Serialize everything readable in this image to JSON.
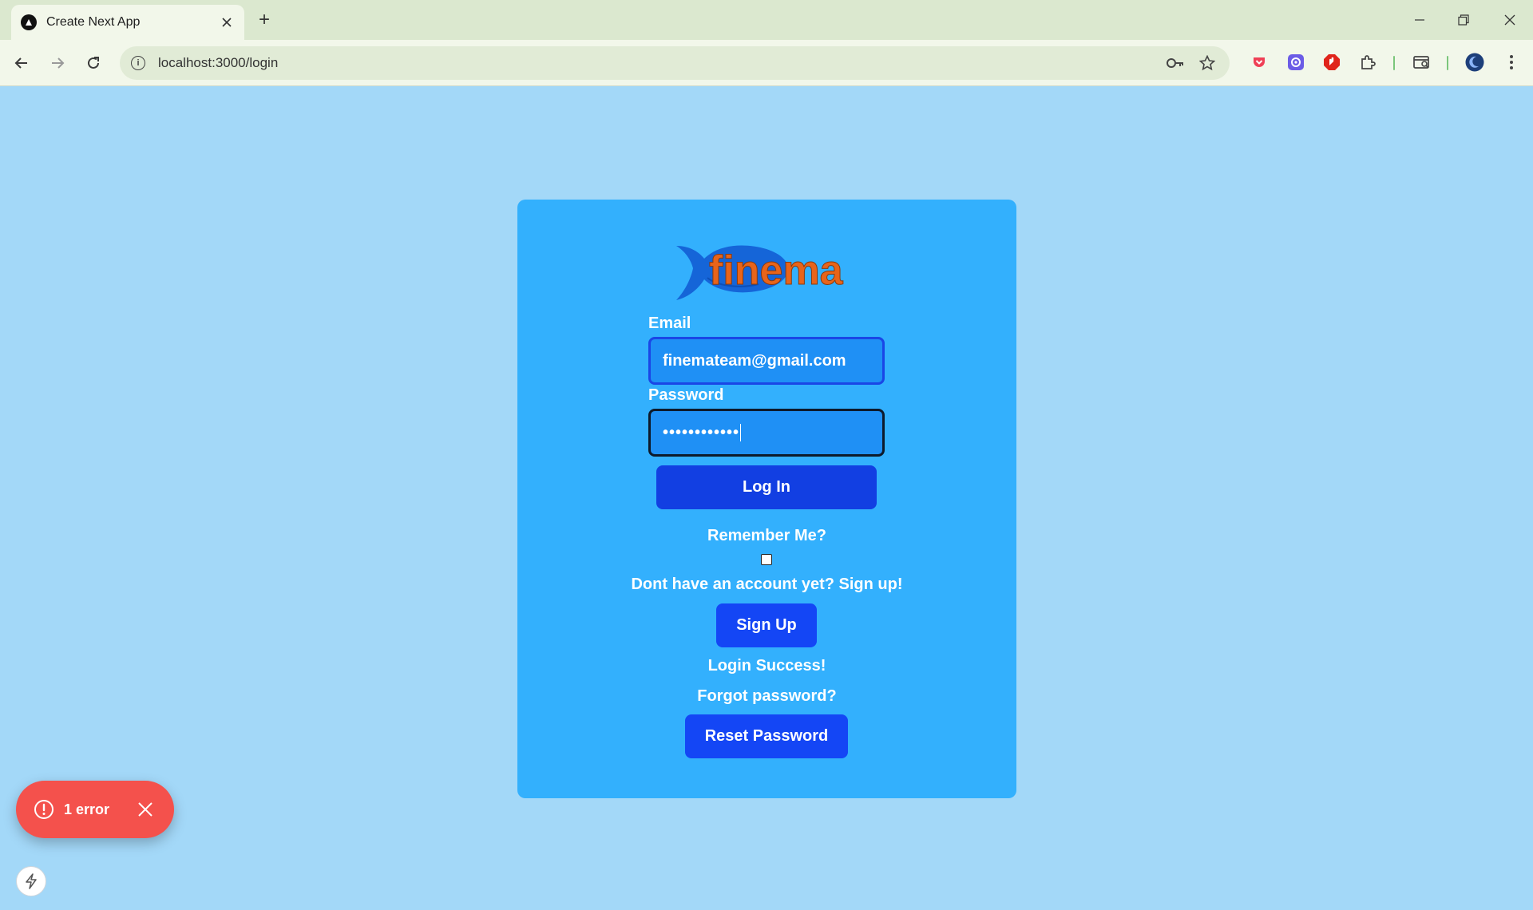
{
  "browser": {
    "tab_title": "Create Next App",
    "new_tab_symbol": "+",
    "url": "localhost:3000/login",
    "tab_favicon_icon": "nextjs-icon",
    "toolbar_icons": [
      "back-icon",
      "forward-icon",
      "reload-icon",
      "site-info-icon",
      "password-key-icon",
      "bookmark-star-icon",
      "pocket-extension-icon",
      "dark-reader-extension-icon",
      "adblock-extension-icon",
      "extensions-puzzle-icon",
      "tab-search-icon",
      "profile-avatar",
      "more-menu-icon"
    ]
  },
  "login_form": {
    "logo_text": "finema",
    "email_label": "Email",
    "email_value": "finemateam@gmail.com",
    "password_label": "Password",
    "password_masked": "••••••••••••",
    "login_button": "Log In",
    "remember_me_label": "Remember Me?",
    "remember_me_checked": false,
    "signup_prompt": "Dont have an account yet? Sign up!",
    "signup_button": "Sign Up",
    "status_message": "Login Success!",
    "forgot_password_text": "Forgot password?",
    "reset_button": "Reset Password"
  },
  "dev_overlay": {
    "error_label": "1 error"
  },
  "colors": {
    "page_background": "#a3d8f8",
    "card_background": "#33b0fd",
    "primary_button": "#123fe2",
    "secondary_button": "#1446f5",
    "logo_fish": "#1565d8",
    "logo_text": "#e8641a",
    "error_pill": "#f4514c"
  }
}
